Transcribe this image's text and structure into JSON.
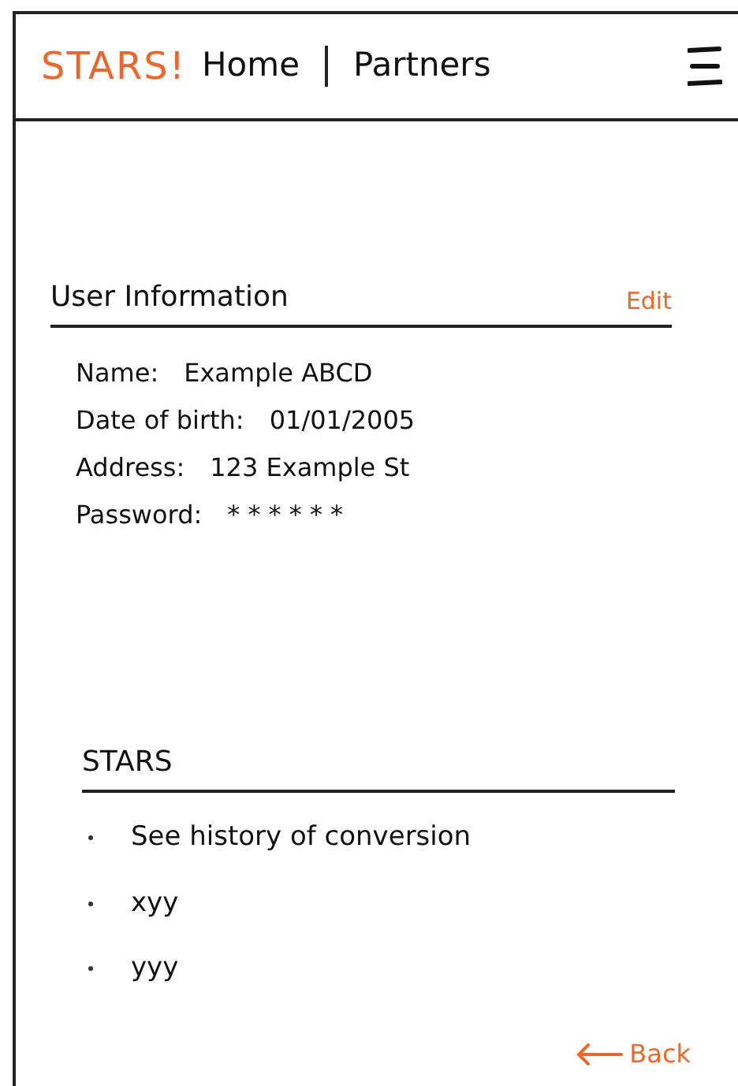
{
  "header": {
    "brand": "STARS!",
    "nav": [
      {
        "label": "Home"
      },
      {
        "label": "Partners"
      }
    ]
  },
  "user_information": {
    "title": "User Information",
    "edit": "Edit",
    "fields": [
      {
        "label": "Name:",
        "value": "Example ABCD"
      },
      {
        "label": "Date of birth:",
        "value": "01/01/2005"
      },
      {
        "label": "Address:",
        "value": "123 Example St"
      },
      {
        "label": "Password:",
        "value": "* * * * * *"
      }
    ]
  },
  "stars": {
    "title": "STARS",
    "items": [
      "See history of conversion",
      "xyy",
      "yyy"
    ]
  },
  "back": "Back"
}
